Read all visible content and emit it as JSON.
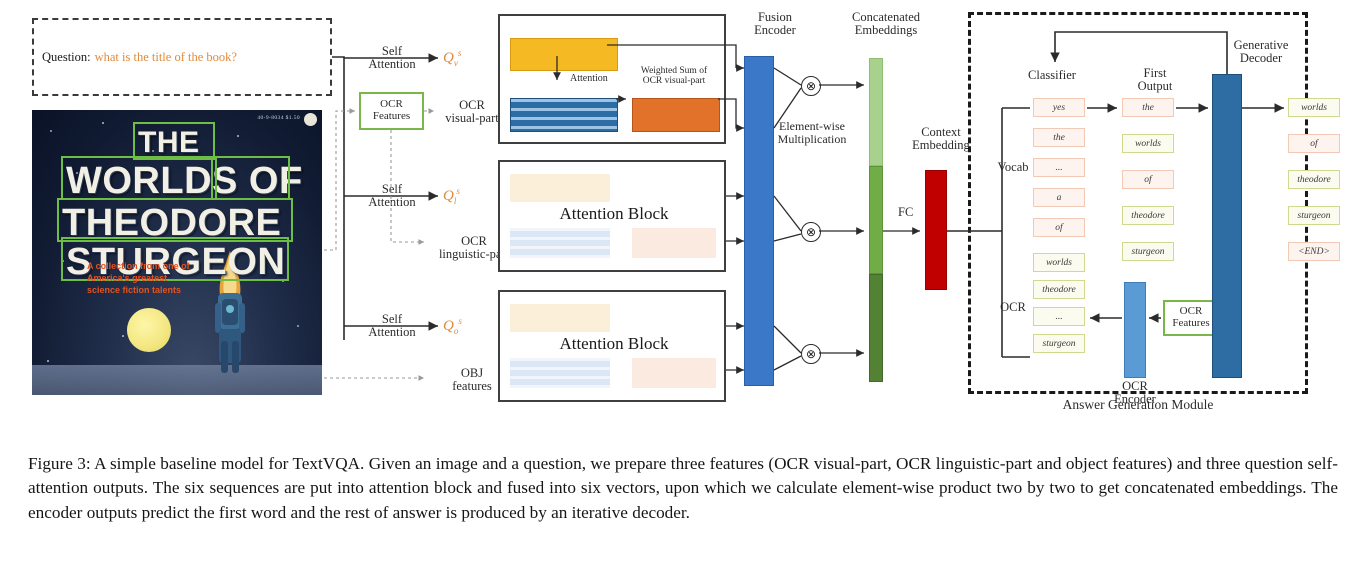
{
  "figure": {
    "caption": "Figure 3: A simple baseline model for TextVQA. Given an image and a question, we prepare three features (OCR visual-part, OCR linguistic-part and object features) and three question self-attention outputs. The six sequences are put into attention block and fused into six vectors, upon which we calculate element-wise product two by two to get concatenated embeddings. The encoder outputs predict the first word and the rest of answer is produced by an iterative decoder."
  },
  "question": {
    "lead": "Question:",
    "text": "what is the title of the book?"
  },
  "book_cover": {
    "words": [
      "THE",
      "WORLDS OF",
      "THEODORE",
      "STURGEON"
    ],
    "subtitle": "A collection from one of\nAmerica's greatest\nscience fiction talents",
    "code": "40-9-8034 $1.50"
  },
  "branches": [
    {
      "self_attention": "Self\nAttention",
      "q_symbol": "Q",
      "q_sub": "v",
      "q_sup": "s",
      "feature": "OCR\nvisual-part"
    },
    {
      "self_attention": "Self\nAttention",
      "q_symbol": "Q",
      "q_sub": "l",
      "q_sup": "s",
      "feature": "OCR\nlinguistic-part"
    },
    {
      "self_attention": "Self\nAttention",
      "q_symbol": "Q",
      "q_sub": "o",
      "q_sup": "s",
      "feature": "OBJ\nfeatures"
    }
  ],
  "ocr_features_box": "OCR\nFeatures",
  "attention_block": {
    "attention_label": "Attention",
    "weighted_sum_label": "Weighted Sum of\nOCR visual-part",
    "block_label": "Attention Block"
  },
  "fusion": {
    "encoder_label": "Fusion\nEncoder",
    "concat_label": "Concatenated\nEmbeddings",
    "elementwise_label": "Element-wise\nMultiplication",
    "context_label": "Context\nEmbedding",
    "fc_label": "FC",
    "multiply_glyph": "⊗"
  },
  "answer_module": {
    "title": "Answer Generation Module",
    "classifier_label": "Classifier",
    "vocab_label": "Vocab",
    "ocr_label": "OCR",
    "first_output_label": "First\nOutput",
    "decoder_label": "Generative\nDecoder",
    "ocr_encoder_label": "OCR\nEncoder",
    "ocr_features_label": "OCR\nFeatures",
    "vocab_items": [
      "yes",
      "the",
      "...",
      "a",
      "of"
    ],
    "ocr_items": [
      "worlds",
      "theodore",
      "...",
      "sturgeon"
    ],
    "first_output_items": [
      "the",
      "worlds",
      "of",
      "theodore",
      "sturgeon"
    ],
    "final_output_items": [
      "worlds",
      "of",
      "theodore",
      "sturgeon",
      "<END>"
    ]
  },
  "colors": {
    "accent_orange": "#E08A3C",
    "ocr_green": "#6EBE45",
    "yellow_box": "#F5B924",
    "blue_stripe": "#2E6DA4",
    "fusion_blue": "#3C78C8",
    "orange_box": "#E2722A",
    "concat_green_light": "#A9D18E",
    "concat_green_mid": "#70AD47",
    "concat_green_dark": "#548235",
    "context_red": "#C00000",
    "decoder_blue": "#2E6DA4",
    "ocr_encoder_blue": "#5B9BD5"
  }
}
